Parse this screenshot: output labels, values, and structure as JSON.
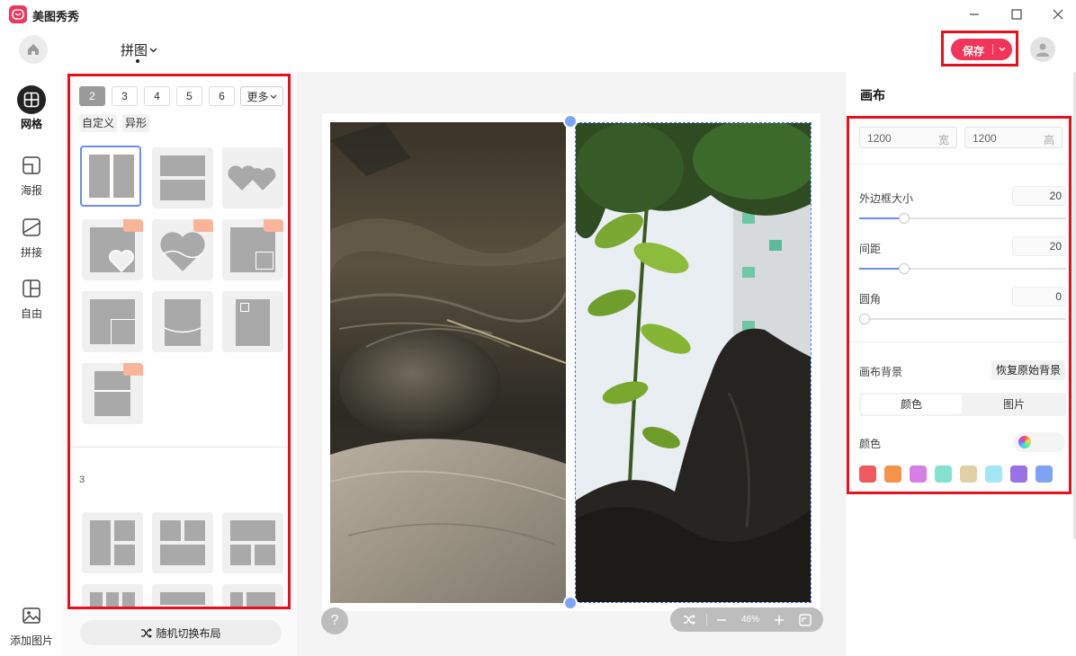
{
  "app": {
    "title": "美图秀秀"
  },
  "toolbar": {
    "mode_title": "拼图",
    "save_label": "保存"
  },
  "nav": [
    {
      "label": "网格",
      "icon": "grid-icon"
    },
    {
      "label": "海报",
      "icon": "poster-icon"
    },
    {
      "label": "拼接",
      "icon": "splice-icon"
    },
    {
      "label": "自由",
      "icon": "free-layout-icon"
    }
  ],
  "add_image_label": "添加图片",
  "layout_panel": {
    "counts": [
      "2",
      "3",
      "4",
      "5",
      "6"
    ],
    "active_count": "2",
    "more_label": "更多",
    "sub_tabs": [
      "自定义",
      "异形"
    ],
    "section_number": "3",
    "shuffle_label": "随机切换布局"
  },
  "canvas": {
    "zoom_level": "46%",
    "help_label": "?"
  },
  "settings": {
    "title": "画布",
    "width_value": "1200",
    "width_unit": "宽",
    "height_value": "1200",
    "height_unit": "高",
    "border_label": "外边框大小",
    "border_value": "20",
    "spacing_label": "间距",
    "spacing_value": "20",
    "corner_label": "圆角",
    "corner_value": "0",
    "bg_label": "画布背景",
    "reset_bg_label": "恢复原始背景",
    "bg_tabs": [
      "颜色",
      "图片"
    ],
    "color_label": "颜色",
    "accent": "#f0345a",
    "swatches": [
      "#ee5a5f",
      "#f4934a",
      "#d77ee6",
      "#86e1cf",
      "#e2cfa6",
      "#a5e6f4",
      "#9a72e4",
      "#7fa3f4"
    ]
  }
}
